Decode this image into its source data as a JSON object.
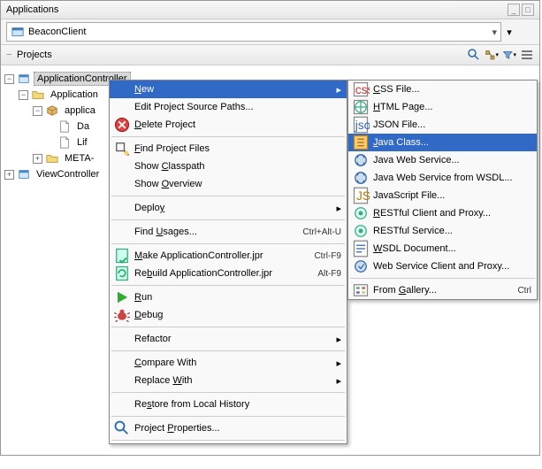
{
  "applications_panel": {
    "title": "Applications",
    "combo_value": "BeaconClient"
  },
  "projects_panel": {
    "title": "Projects",
    "toolbar_icons": [
      "search-icon",
      "nav-icon",
      "filter-icon",
      "menu-icon"
    ]
  },
  "tree": {
    "root": "ApplicationController",
    "n1": "Application",
    "n2": "applica",
    "n3": "Da",
    "n4": "Lif",
    "n5": "META-",
    "n6": "ViewController"
  },
  "context_menu": [
    {
      "label": "New",
      "icon": "",
      "submenu_arrow": true,
      "highlighted": true,
      "u": 0
    },
    {
      "label": "Edit Project Source Paths...",
      "icon": ""
    },
    {
      "label": "Delete Project",
      "icon": "delete-icon",
      "u": 0
    },
    {
      "sep": true
    },
    {
      "label": "Find Project Files",
      "icon": "find-icon",
      "u": 0
    },
    {
      "label": "Show Classpath",
      "u": 5
    },
    {
      "label": "Show Overview",
      "u": 5
    },
    {
      "sep": true
    },
    {
      "label": "Deploy",
      "submenu_arrow": true,
      "u": 5
    },
    {
      "sep": true
    },
    {
      "label": "Find Usages...",
      "shortcut": "Ctrl+Alt-U",
      "u": 5
    },
    {
      "sep": true
    },
    {
      "label": "Make ApplicationController.jpr",
      "icon": "make-icon",
      "shortcut": "Ctrl-F9",
      "u": 0
    },
    {
      "label": "Rebuild ApplicationController.jpr",
      "icon": "rebuild-icon",
      "shortcut": "Alt-F9",
      "u": 2
    },
    {
      "sep": true
    },
    {
      "label": "Run",
      "icon": "run-icon",
      "u": 0
    },
    {
      "label": "Debug",
      "icon": "debug-icon",
      "u": 0
    },
    {
      "sep": true
    },
    {
      "label": "Refactor",
      "submenu_arrow": true
    },
    {
      "sep": true
    },
    {
      "label": "Compare With",
      "submenu_arrow": true,
      "u": 0
    },
    {
      "label": "Replace With",
      "submenu_arrow": true,
      "u": 8
    },
    {
      "sep": true
    },
    {
      "label": "Restore from Local History",
      "u": 2
    },
    {
      "sep": true
    },
    {
      "label": "Project Properties...",
      "icon": "props-icon",
      "u": 8
    },
    {
      "sep": true
    }
  ],
  "new_submenu": [
    {
      "label": "CSS File...",
      "icon": "css-icon",
      "u": 0
    },
    {
      "label": "HTML Page...",
      "icon": "html-icon",
      "u": 0
    },
    {
      "label": "JSON File...",
      "icon": "json-icon"
    },
    {
      "label": "Java Class...",
      "icon": "java-icon",
      "highlighted": true,
      "u": 0
    },
    {
      "label": "Java Web Service...",
      "icon": "jws-icon"
    },
    {
      "label": "Java Web Service from WSDL...",
      "icon": "jws-icon"
    },
    {
      "label": "JavaScript File...",
      "icon": "js-icon"
    },
    {
      "label": "RESTful Client and Proxy...",
      "icon": "rest-icon",
      "u": 0
    },
    {
      "label": "RESTful Service...",
      "icon": "rest-icon"
    },
    {
      "label": "WSDL Document...",
      "icon": "wsdl-icon",
      "u": 0
    },
    {
      "label": "Web Service Client and Proxy...",
      "icon": "wsc-icon"
    },
    {
      "sep": true
    },
    {
      "label": "From Gallery...",
      "icon": "gallery-icon",
      "shortcut": "Ctrl",
      "u": 5
    }
  ]
}
